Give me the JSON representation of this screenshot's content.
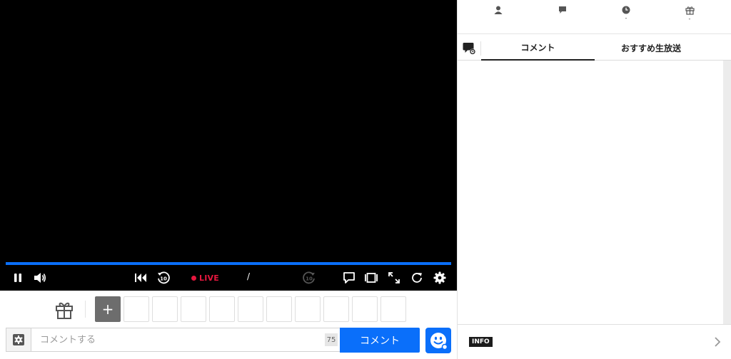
{
  "player": {
    "live_label": "LIVE",
    "time_separator": "/",
    "accent_color": "#0a6ffa",
    "live_color": "#e6173e",
    "controls": [
      "pause-icon",
      "volume-icon",
      "skip-to-start-icon",
      "rewind-10-icon",
      "forward-10-icon",
      "comment-toggle-icon",
      "theater-mode-icon",
      "fullscreen-icon",
      "reload-icon",
      "settings-icon"
    ]
  },
  "gift_bar": {
    "add_label": "+",
    "slot_count": 10
  },
  "comment_bar": {
    "placeholder": "コメントする",
    "char_count": "75",
    "submit_label": "コメント"
  },
  "side_panel": {
    "stats": [
      {
        "icon": "viewer-icon",
        "value": ""
      },
      {
        "icon": "comment-count-icon",
        "value": ""
      },
      {
        "icon": "clock-icon",
        "value": "-"
      },
      {
        "icon": "gift-icon",
        "value": "-"
      }
    ],
    "tabs": [
      {
        "label": "コメント",
        "active": true
      },
      {
        "label": "おすすめ生放送",
        "active": false
      }
    ],
    "info_badge": "INFO"
  }
}
